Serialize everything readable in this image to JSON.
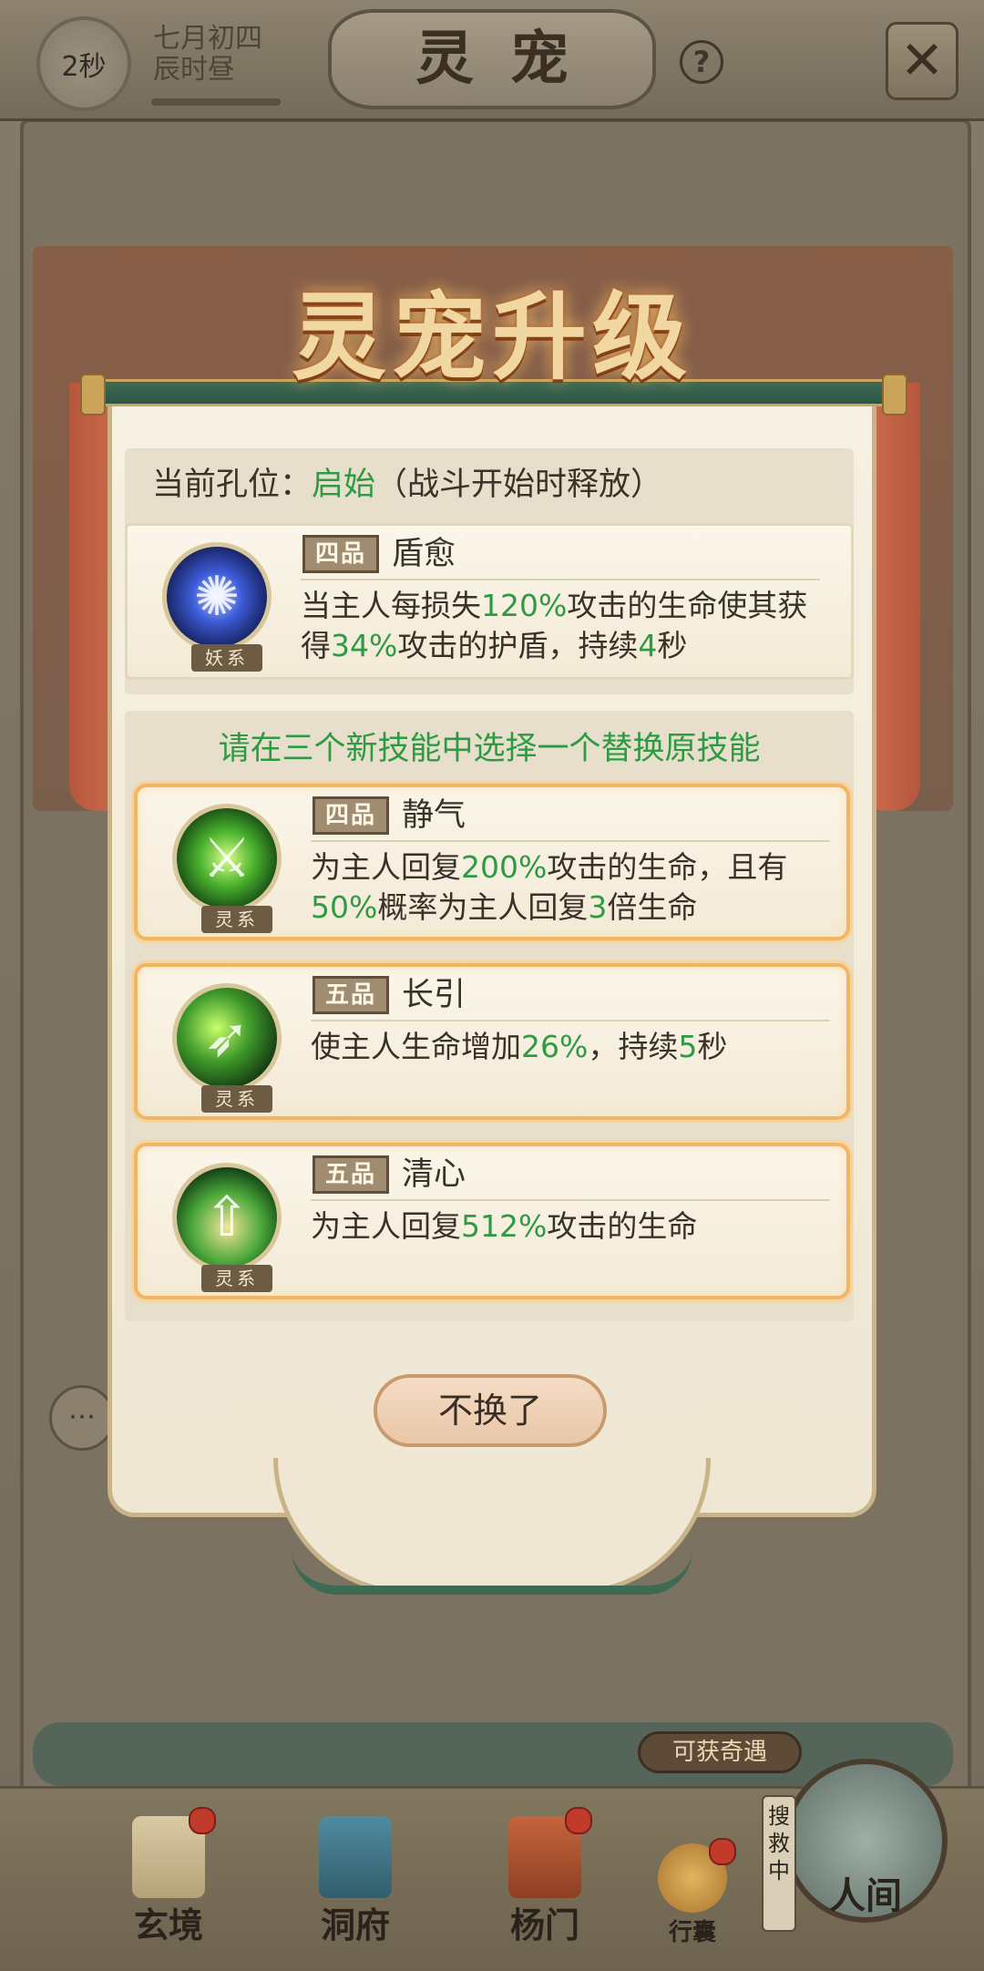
{
  "topbar": {
    "timer": "2秒",
    "date_line1": "七月初四",
    "date_line2": "辰时昼",
    "title": "灵宠",
    "help": "?",
    "close": "✕"
  },
  "dialog": {
    "header": "灵宠升级",
    "slot_label": "当前孔位：",
    "slot_name": "启始",
    "slot_note": "（战斗开始时释放）",
    "current_skill": {
      "grade": "四品",
      "name": "盾愈",
      "type_tag": "妖系",
      "desc": [
        {
          "t": "当主人每损失",
          "g": false
        },
        {
          "t": "120%",
          "g": true
        },
        {
          "t": "攻击的生命使其获得",
          "g": false
        },
        {
          "t": "34%",
          "g": true
        },
        {
          "t": "攻击的护盾，持续",
          "g": false
        },
        {
          "t": "4",
          "g": true
        },
        {
          "t": "秒",
          "g": false
        }
      ]
    },
    "choose_hint": "请在三个新技能中选择一个替换原技能",
    "choices": [
      {
        "grade": "四品",
        "name": "静气",
        "type_tag": "灵系",
        "desc": [
          {
            "t": "为主人回复",
            "g": false
          },
          {
            "t": "200%",
            "g": true
          },
          {
            "t": "攻击的生命，且有",
            "g": false
          },
          {
            "t": "50%",
            "g": true
          },
          {
            "t": "概率为主人回复",
            "g": false
          },
          {
            "t": "3",
            "g": true
          },
          {
            "t": "倍生命",
            "g": false
          }
        ]
      },
      {
        "grade": "五品",
        "name": "长引",
        "type_tag": "灵系",
        "desc": [
          {
            "t": "使主人生命增加",
            "g": false
          },
          {
            "t": "26%",
            "g": true
          },
          {
            "t": "，持续",
            "g": false
          },
          {
            "t": "5",
            "g": true
          },
          {
            "t": "秒",
            "g": false
          }
        ]
      },
      {
        "grade": "五品",
        "name": "清心",
        "type_tag": "灵系",
        "desc": [
          {
            "t": "为主人回复",
            "g": false
          },
          {
            "t": "512%",
            "g": true
          },
          {
            "t": "攻击的生命",
            "g": false
          }
        ]
      }
    ],
    "no_swap_button": "不换了"
  },
  "bottom_nav": {
    "items": [
      {
        "label": "玄境"
      },
      {
        "label": "洞府"
      },
      {
        "label": "杨门"
      },
      {
        "label": "行囊"
      },
      {
        "label": "人间"
      }
    ],
    "encounter": "可获奇遇",
    "searching": "搜救中"
  },
  "colors": {
    "accent_green": "#2e9b44",
    "card_border": "#f0b566",
    "header_gold": "#f1d7a1"
  }
}
